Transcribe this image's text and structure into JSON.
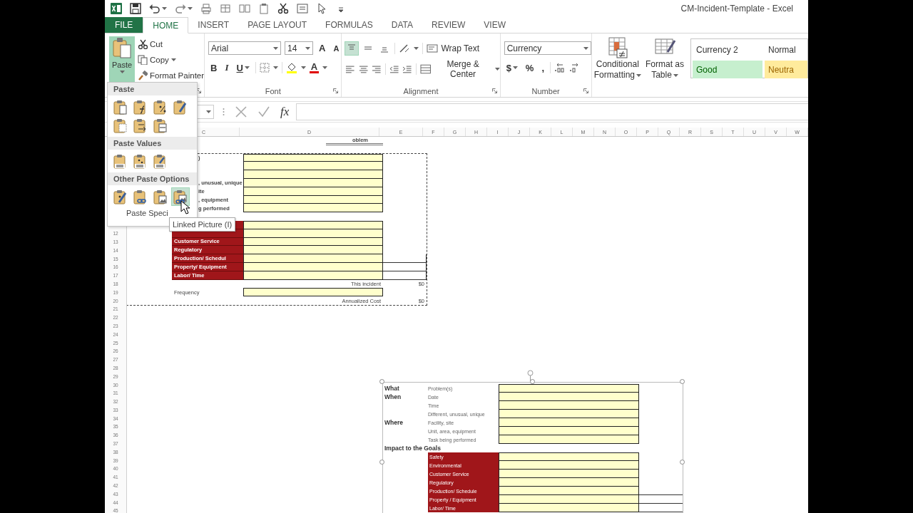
{
  "window": {
    "title": "CM-Incident-Template - Excel"
  },
  "quick_access": [
    {
      "kind": "excel"
    },
    {
      "kind": "save"
    },
    {
      "kind": "undo",
      "menu": true
    },
    {
      "kind": "redo",
      "menu": true
    },
    {
      "kind": "print"
    },
    {
      "kind": "table"
    },
    {
      "kind": "columns"
    },
    {
      "kind": "clipboard"
    },
    {
      "kind": "cut"
    },
    {
      "kind": "form"
    },
    {
      "kind": "pointer"
    },
    {
      "kind": "customize"
    }
  ],
  "tabs": [
    {
      "label": "FILE",
      "kind": "file",
      "selected": false
    },
    {
      "label": "HOME",
      "kind": "tab",
      "selected": true
    },
    {
      "label": "INSERT",
      "kind": "tab",
      "selected": false
    },
    {
      "label": "PAGE LAYOUT",
      "kind": "tab",
      "selected": false
    },
    {
      "label": "FORMULAS",
      "kind": "tab",
      "selected": false
    },
    {
      "label": "DATA",
      "kind": "tab",
      "selected": false
    },
    {
      "label": "REVIEW",
      "kind": "tab",
      "selected": false
    },
    {
      "label": "VIEW",
      "kind": "tab",
      "selected": false
    }
  ],
  "ribbon": {
    "clipboard": {
      "paste": {
        "label": "Paste",
        "selected": true
      },
      "items": [
        {
          "kind": "cut",
          "label": "Cut",
          "menu": false
        },
        {
          "kind": "copy",
          "label": "Copy",
          "menu": true
        },
        {
          "kind": "format-painter",
          "label": "Format Painter",
          "menu": false
        }
      ]
    },
    "font": {
      "label": "Font",
      "font_name": "Arial",
      "font_size": "14",
      "grow": "A",
      "shrink": "A",
      "styles": [
        {
          "kind": "bold",
          "label": "B",
          "menu": false
        },
        {
          "kind": "italic",
          "label": "I",
          "menu": false
        },
        {
          "kind": "underline",
          "label": "U",
          "menu": true
        }
      ],
      "font_color": "A"
    },
    "alignment": {
      "label": "Alignment",
      "vertical_align": [
        {
          "kind": "top",
          "selected": true
        },
        {
          "kind": "middle",
          "selected": false
        },
        {
          "kind": "bottom",
          "selected": false
        }
      ],
      "wrap_text": "Wrap Text",
      "merge": "Merge & Center"
    },
    "number": {
      "label": "Number",
      "format": "Currency",
      "symbols": [
        {
          "label": "$",
          "menu": true
        },
        {
          "label": "%",
          "menu": false
        },
        {
          "label": ",",
          "menu": false
        }
      ]
    },
    "styles": {
      "buttons": [
        {
          "kind": "conditional",
          "label": "Conditional",
          "label_2": "Formatting"
        },
        {
          "kind": "table",
          "label": "Format as",
          "label_2": "Table"
        }
      ],
      "gallery": [
        {
          "kind": "plain",
          "label": "Currency 2"
        },
        {
          "kind": "plain",
          "label": "Normal"
        },
        {
          "kind": "good",
          "label": "Good"
        },
        {
          "kind": "neutral",
          "label": "Neutra"
        }
      ]
    }
  },
  "formula_bar": {
    "function_label": "fx"
  },
  "paste_menu": {
    "sections": [
      {
        "title": "Paste",
        "options": [
          {
            "kind": "paste",
            "hovered": false
          },
          {
            "kind": "formulas",
            "hovered": false
          },
          {
            "kind": "formulas-number",
            "hovered": false
          },
          {
            "kind": "keep-source",
            "hovered": false
          },
          {
            "kind": "no-borders",
            "hovered": false
          },
          {
            "kind": "transpose",
            "hovered": false
          },
          {
            "kind": "column-widths",
            "hovered": false
          }
        ]
      },
      {
        "title": "Paste Values",
        "options": [
          {
            "kind": "values",
            "hovered": false
          },
          {
            "kind": "values-number",
            "hovered": false
          },
          {
            "kind": "values-source",
            "hovered": false
          }
        ]
      },
      {
        "title": "Other Paste Options",
        "options": [
          {
            "kind": "formatting",
            "hovered": false
          },
          {
            "kind": "link",
            "hovered": false
          },
          {
            "kind": "picture",
            "hovered": false
          },
          {
            "kind": "linked-picture",
            "hovered": true
          }
        ]
      }
    ],
    "footer": "Paste Speci",
    "tooltip": "Linked Picture (I)"
  },
  "sheet": {
    "columns": [
      "C",
      "D",
      "E",
      "F",
      "G",
      "H",
      "I",
      "J",
      "K",
      "L",
      "M",
      "N",
      "O",
      "P",
      "Q",
      "R",
      "S",
      "T",
      "U",
      "V",
      "W"
    ],
    "row_numbers": [
      "12",
      "13",
      "14",
      "15",
      "16",
      "17",
      "18",
      "19",
      "20",
      "21",
      "22",
      "23",
      "24",
      "25",
      "26",
      "27",
      "28",
      "29",
      "30",
      "31",
      "32",
      "33",
      "34",
      "35",
      "36",
      "37",
      "38",
      "39",
      "40",
      "41",
      "42",
      "43",
      "44",
      "45"
    ],
    "template": [
      {
        "kind": "title",
        "label": "oblem"
      },
      {
        "kind": "blank"
      },
      {
        "kind": "field",
        "label": ")"
      },
      {
        "kind": "field"
      },
      {
        "kind": "field"
      },
      {
        "kind": "field",
        "label": ", unusual, unique"
      },
      {
        "kind": "field",
        "label": "ite"
      },
      {
        "kind": "field",
        "label": ", equipment"
      },
      {
        "kind": "field",
        "label": "g performed"
      },
      {
        "kind": "blank"
      },
      {
        "kind": "impact",
        "tail": false
      },
      {
        "kind": "impact",
        "tail": false
      },
      {
        "kind": "impact",
        "label": "Customer Service",
        "tail": false
      },
      {
        "kind": "impact",
        "label": "Regulatory",
        "tail": false
      },
      {
        "kind": "impact",
        "label": "Production/ Schedul",
        "tail": true
      },
      {
        "kind": "impact",
        "label": "Property/ Equipment",
        "tail": true
      },
      {
        "kind": "impact",
        "label": "Labor/ Time",
        "tail": true
      },
      {
        "kind": "total",
        "label": "This incident",
        "value": "$0"
      },
      {
        "kind": "frequency",
        "label": "Frequency"
      },
      {
        "kind": "total",
        "label": "Annualized Cost",
        "value": "$0"
      }
    ],
    "picture": [
      {
        "kind": "field",
        "group": "What",
        "label": "Problem(s)"
      },
      {
        "kind": "field",
        "group": "When",
        "label": "Date"
      },
      {
        "kind": "field",
        "label": "Time"
      },
      {
        "kind": "field",
        "label": "Different, unusual, unique"
      },
      {
        "kind": "field",
        "group": "Where",
        "label": "Facility, site"
      },
      {
        "kind": "field",
        "label": "Unit, area, equipment"
      },
      {
        "kind": "field",
        "label": "Task being performed"
      },
      {
        "kind": "heading",
        "label": "Impact to the Goals"
      },
      {
        "kind": "impact",
        "label": "Safety",
        "tail": false
      },
      {
        "kind": "impact",
        "label": "Environmental",
        "tail": false
      },
      {
        "kind": "impact",
        "label": "Customer Service",
        "tail": false
      },
      {
        "kind": "impact",
        "label": "Regulatory",
        "tail": false
      },
      {
        "kind": "impact",
        "label": "Production/ Schedule",
        "tail": true
      },
      {
        "kind": "impact",
        "label": "Property / Equipment",
        "tail": true
      },
      {
        "kind": "impact",
        "label": "Labor/ Time",
        "tail": true
      }
    ]
  }
}
